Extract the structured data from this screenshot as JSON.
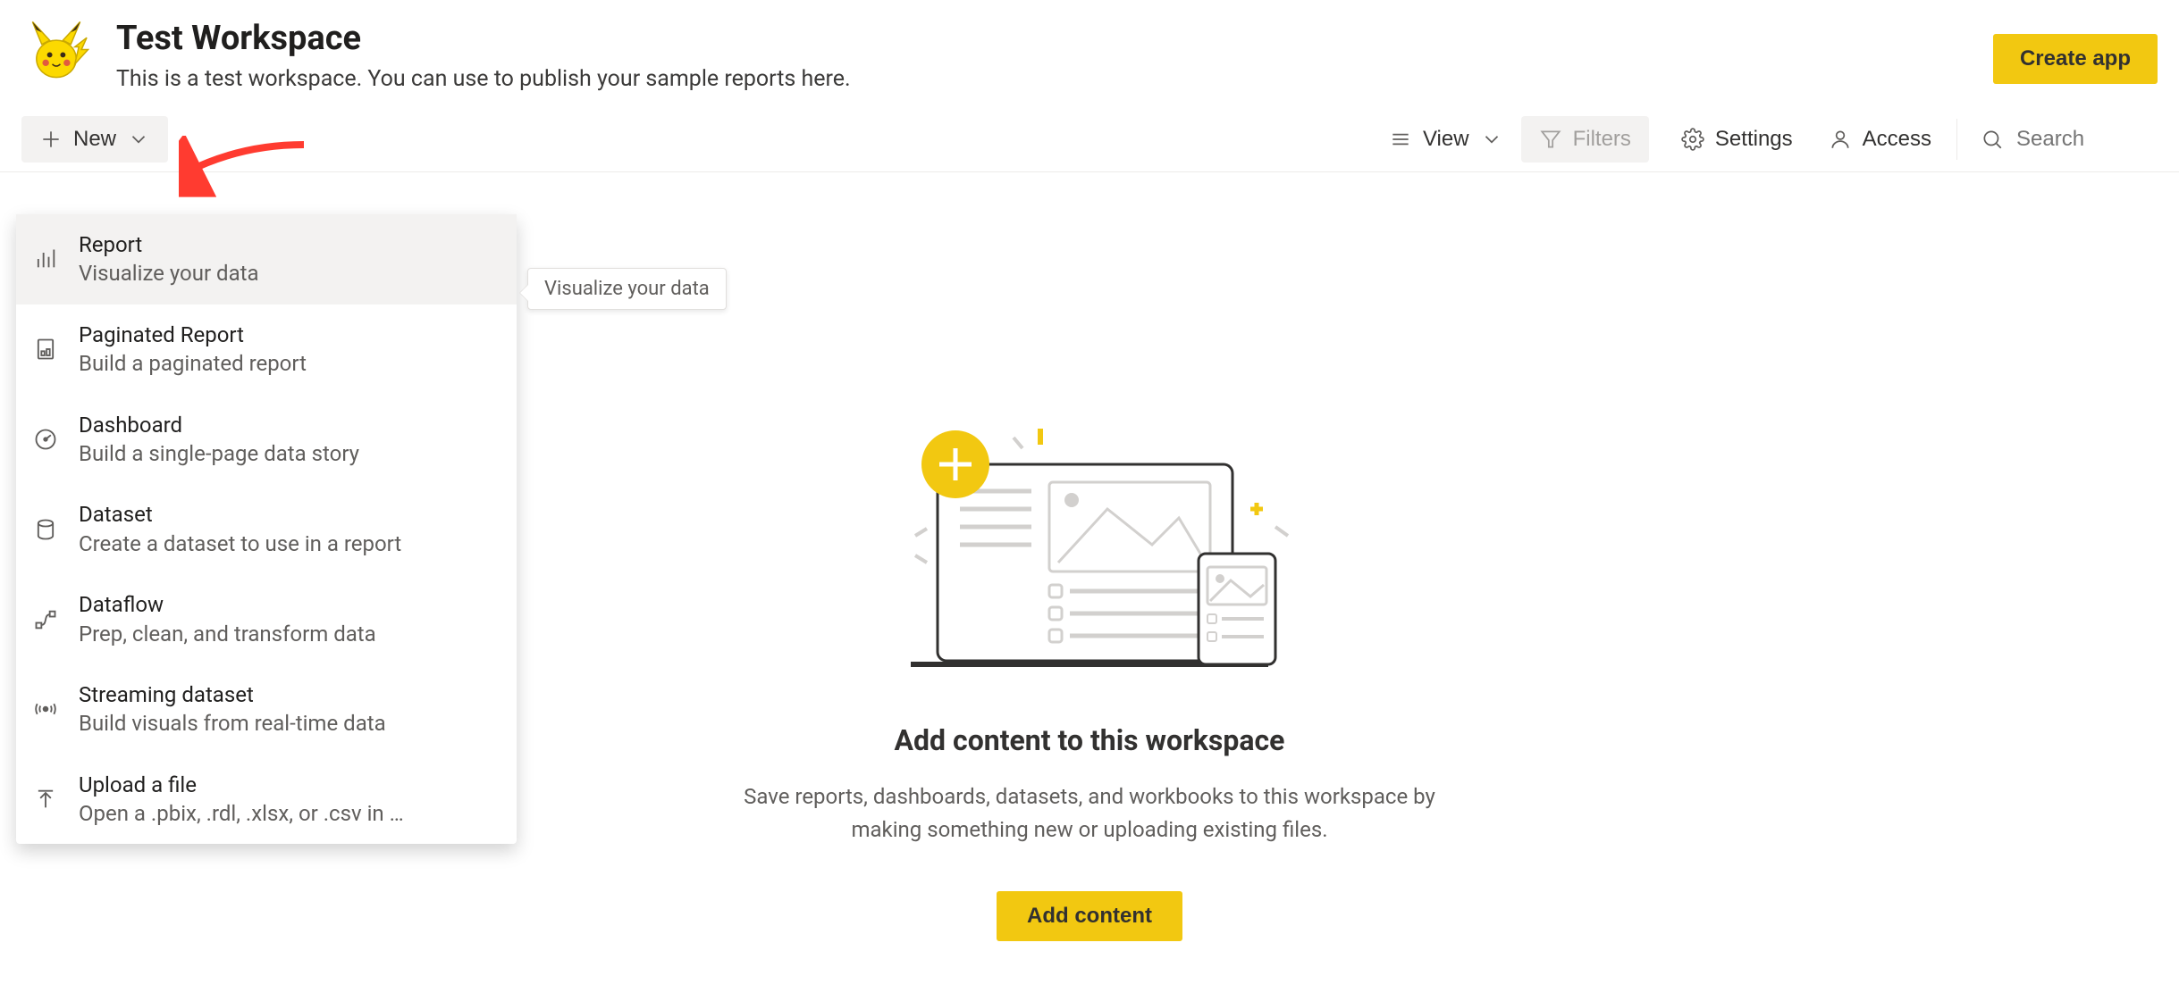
{
  "header": {
    "title": "Test Workspace",
    "description": "This is a test workspace. You can use to publish your sample reports here.",
    "create_app_label": "Create app"
  },
  "toolbar": {
    "new_label": "New",
    "view_label": "View",
    "filters_label": "Filters",
    "settings_label": "Settings",
    "access_label": "Access",
    "search_placeholder": "Search"
  },
  "new_menu": {
    "items": [
      {
        "title": "Report",
        "subtitle": "Visualize your data",
        "icon": "bar-chart-icon",
        "highlight": true
      },
      {
        "title": "Paginated Report",
        "subtitle": "Build a paginated report",
        "icon": "page-icon"
      },
      {
        "title": "Dashboard",
        "subtitle": "Build a single-page data story",
        "icon": "gauge-icon"
      },
      {
        "title": "Dataset",
        "subtitle": "Create a dataset to use in a report",
        "icon": "database-icon"
      },
      {
        "title": "Dataflow",
        "subtitle": "Prep, clean, and transform data",
        "icon": "flow-icon"
      },
      {
        "title": "Streaming dataset",
        "subtitle": "Build visuals from real-time data",
        "icon": "broadcast-icon"
      },
      {
        "title": "Upload a file",
        "subtitle": "Open a .pbix, .rdl, .xlsx, or .csv in …",
        "icon": "upload-icon"
      }
    ]
  },
  "tooltip_text": "Visualize your data",
  "empty": {
    "title": "Add content to this workspace",
    "desc": "Save reports, dashboards, datasets, and workbooks to this workspace by making something new or uploading existing files.",
    "button": "Add content"
  }
}
